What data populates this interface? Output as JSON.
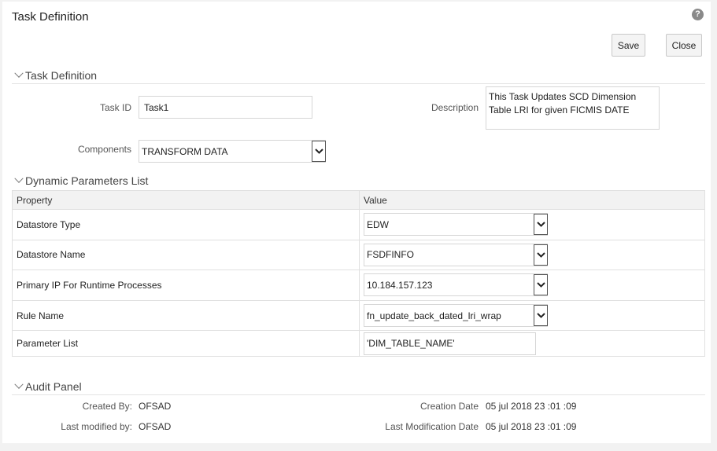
{
  "header": {
    "title": "Task Definition",
    "help_icon": "question-circle-icon"
  },
  "toolbar": {
    "save_label": "Save",
    "close_label": "Close"
  },
  "task_definition": {
    "section_title": "Task Definition",
    "task_id_label": "Task ID",
    "task_id_value": "Task1",
    "description_label": "Description",
    "description_value": "This Task Updates SCD Dimension Table LRI for given FICMIS DATE",
    "components_label": "Components",
    "components_value": "TRANSFORM DATA"
  },
  "dynamic_params": {
    "section_title": "Dynamic Parameters List",
    "columns": [
      "Property",
      "Value"
    ],
    "rows": [
      {
        "property": "Datastore Type",
        "value": "EDW",
        "control": "select"
      },
      {
        "property": "Datastore Name",
        "value": "FSDFINFO",
        "control": "select"
      },
      {
        "property": "Primary IP For Runtime Processes",
        "value": "10.184.157.123",
        "control": "select"
      },
      {
        "property": "Rule Name",
        "value": "fn_update_back_dated_lri_wrap",
        "control": "select"
      },
      {
        "property": "Parameter List",
        "value": "'DIM_TABLE_NAME'",
        "control": "input"
      }
    ]
  },
  "audit": {
    "section_title": "Audit Panel",
    "created_by_label": "Created By:",
    "created_by_value": "OFSAD",
    "modified_by_label": "Last modified by:",
    "modified_by_value": "OFSAD",
    "creation_date_label": "Creation Date",
    "creation_date_value": "05 jul 2018 23 :01 :09",
    "modification_date_label": "Last Modification Date",
    "modification_date_value": "05 jul 2018 23 :01 :09"
  }
}
